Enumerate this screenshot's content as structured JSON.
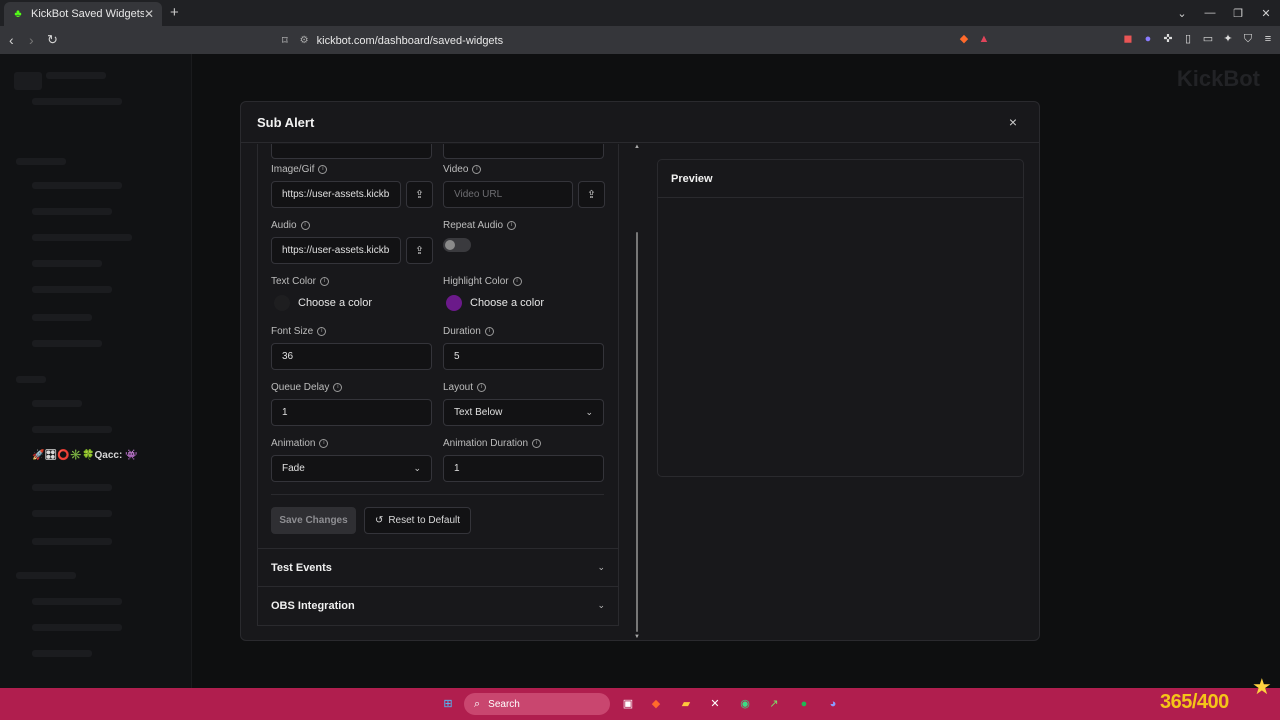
{
  "browser": {
    "tab_title": "KickBot Saved Widgets",
    "tab_icon": "kick-logo-icon",
    "new_tab": "+",
    "url": "kickbot.com/dashboard/saved-widgets"
  },
  "background_page": {
    "brand": "KickBot",
    "user_line": "🚀🎛⭕✳️🍀Qacc: 👾"
  },
  "modal": {
    "title": "Sub Alert",
    "close": "×",
    "fields": {
      "image_gif": {
        "label": "Image/Gif",
        "value": "https://user-assets.kickb"
      },
      "video": {
        "label": "Video",
        "placeholder": "Video URL"
      },
      "audio": {
        "label": "Audio",
        "value": "https://user-assets.kickb"
      },
      "repeat_audio": {
        "label": "Repeat Audio",
        "enabled": false
      },
      "text_color": {
        "label": "Text Color",
        "value": "Choose a color",
        "swatch": "#1e1e20"
      },
      "highlight_color": {
        "label": "Highlight Color",
        "value": "Choose a color",
        "swatch": "#6b1a8a"
      },
      "font_size": {
        "label": "Font Size",
        "value": "36"
      },
      "duration": {
        "label": "Duration",
        "value": "5"
      },
      "queue_delay": {
        "label": "Queue Delay",
        "value": "1"
      },
      "layout": {
        "label": "Layout",
        "value": "Text Below"
      },
      "animation": {
        "label": "Animation",
        "value": "Fade"
      },
      "animation_duration": {
        "label": "Animation Duration",
        "value": "1"
      }
    },
    "buttons": {
      "save": "Save Changes",
      "reset": "Reset to Default"
    },
    "accordions": {
      "test_events": "Test Events",
      "obs_integration": "OBS Integration"
    },
    "preview": {
      "title": "Preview"
    }
  },
  "taskbar": {
    "search": "Search",
    "counter": "365/400"
  }
}
